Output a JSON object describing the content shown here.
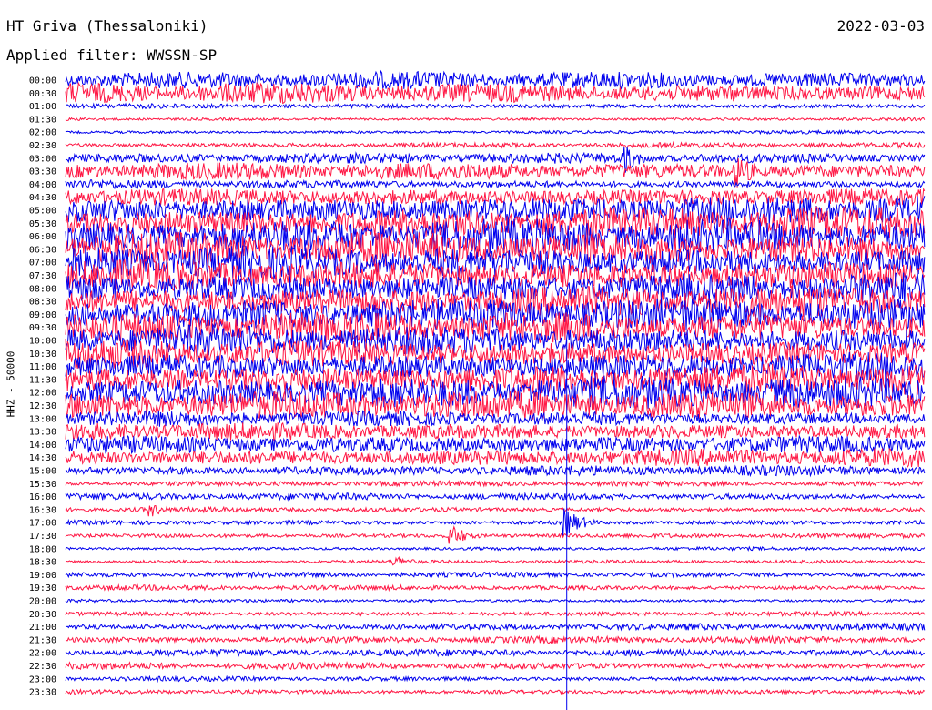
{
  "header": {
    "station": "HT Griva (Thessaloniki)",
    "date": "2022-03-03",
    "filter": "Applied filter: WWSSN-SP"
  },
  "chart_data": {
    "type": "line",
    "title": "HT Griva (Thessaloniki)",
    "ylabel": "HHZ - 50000",
    "row_labels": [
      "00:00",
      "00:30",
      "01:00",
      "01:30",
      "02:00",
      "02:30",
      "03:00",
      "03:30",
      "04:00",
      "04:30",
      "05:00",
      "05:30",
      "06:00",
      "06:30",
      "07:00",
      "07:30",
      "08:00",
      "08:30",
      "09:00",
      "09:30",
      "10:00",
      "10:30",
      "11:00",
      "11:30",
      "12:00",
      "12:30",
      "13:00",
      "13:30",
      "14:00",
      "14:30",
      "15:00",
      "15:30",
      "16:00",
      "16:30",
      "17:00",
      "17:30",
      "18:00",
      "18:30",
      "19:00",
      "19:30",
      "20:00",
      "20:30",
      "21:00",
      "21:30",
      "22:00",
      "22:30",
      "23:00",
      "23:30"
    ],
    "row_colors": [
      "#0000ee",
      "#ff1744"
    ],
    "noise_amplitude": [
      10,
      12,
      3,
      2,
      2,
      3,
      6,
      10,
      5,
      12,
      18,
      19,
      20,
      20,
      20,
      20,
      20,
      19,
      19,
      18,
      18,
      18,
      18,
      19,
      19,
      17,
      9,
      11,
      12,
      11,
      6,
      3,
      4,
      3,
      3,
      3,
      2,
      2,
      3,
      3,
      2,
      3,
      4,
      4,
      4,
      4,
      3,
      3
    ],
    "events": [
      {
        "row": 6,
        "minute": 19.5,
        "amplitude": 18
      },
      {
        "row": 7,
        "minute": 23.5,
        "amplitude": 20
      },
      {
        "row": 35,
        "minute": 13.5,
        "amplitude": 12
      },
      {
        "row": 34,
        "minute": 17.5,
        "amplitude": 16
      },
      {
        "row": 33,
        "minute": 3.0,
        "amplitude": 8
      },
      {
        "row": 37,
        "minute": 11.5,
        "amplitude": 7
      }
    ],
    "vertical_marker": {
      "minute": 17.5,
      "color": "#0000ee"
    }
  }
}
